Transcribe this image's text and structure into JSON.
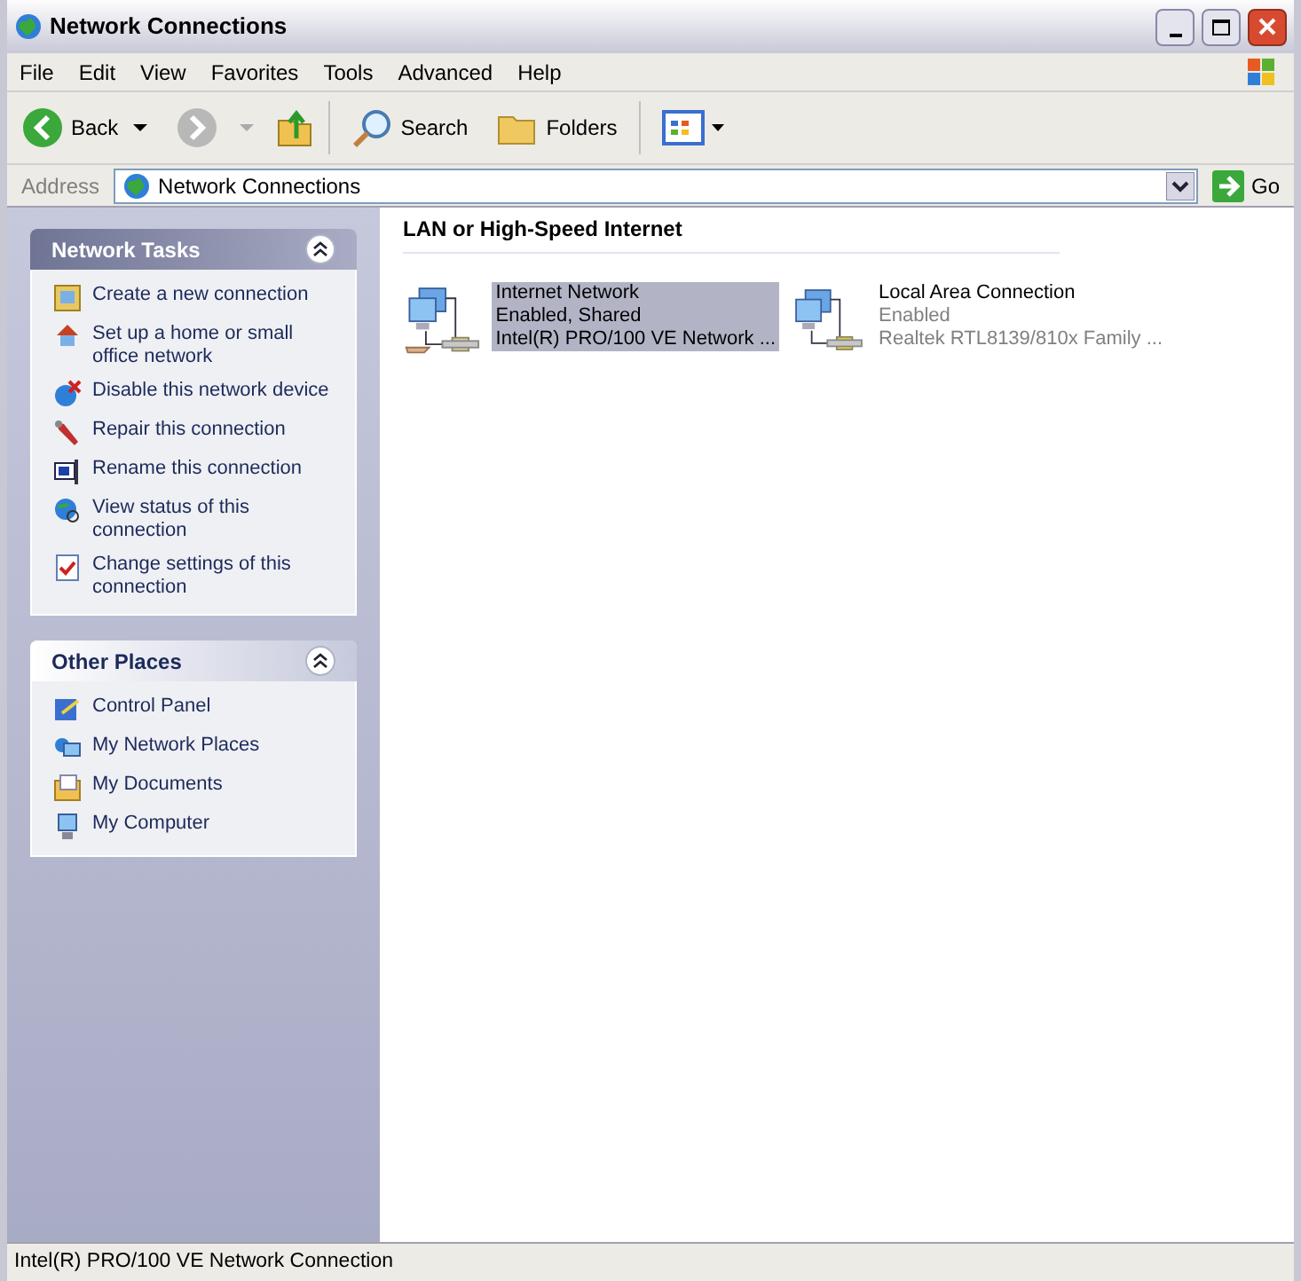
{
  "window": {
    "title": "Network Connections"
  },
  "menu": [
    "File",
    "Edit",
    "View",
    "Favorites",
    "Tools",
    "Advanced",
    "Help"
  ],
  "toolbar": {
    "back": "Back",
    "search": "Search",
    "folders": "Folders"
  },
  "address": {
    "label": "Address",
    "value": "Network Connections",
    "go": "Go"
  },
  "panels": [
    {
      "title": "Network Tasks",
      "items": [
        "Create a new connection",
        "Set up a home or small office network",
        "Disable this network device",
        "Repair this connection",
        "Rename this connection",
        "View status of this connection",
        "Change settings of this connection"
      ]
    },
    {
      "title": "Other Places",
      "items": [
        "Control Panel",
        "My Network Places",
        "My Documents",
        "My Computer"
      ]
    }
  ],
  "group": {
    "title": "LAN or High-Speed Internet",
    "connections": [
      {
        "name": "Internet Network",
        "status": "Enabled, Shared",
        "device": "Intel(R) PRO/100 VE Network ...",
        "selected": true,
        "kind": "shared"
      },
      {
        "name": "Local Area Connection",
        "status": "Enabled",
        "device": "Realtek RTL8139/810x Family ...",
        "selected": false,
        "kind": "plain"
      }
    ]
  },
  "status_bar": "Intel(R) PRO/100 VE Network Connection"
}
